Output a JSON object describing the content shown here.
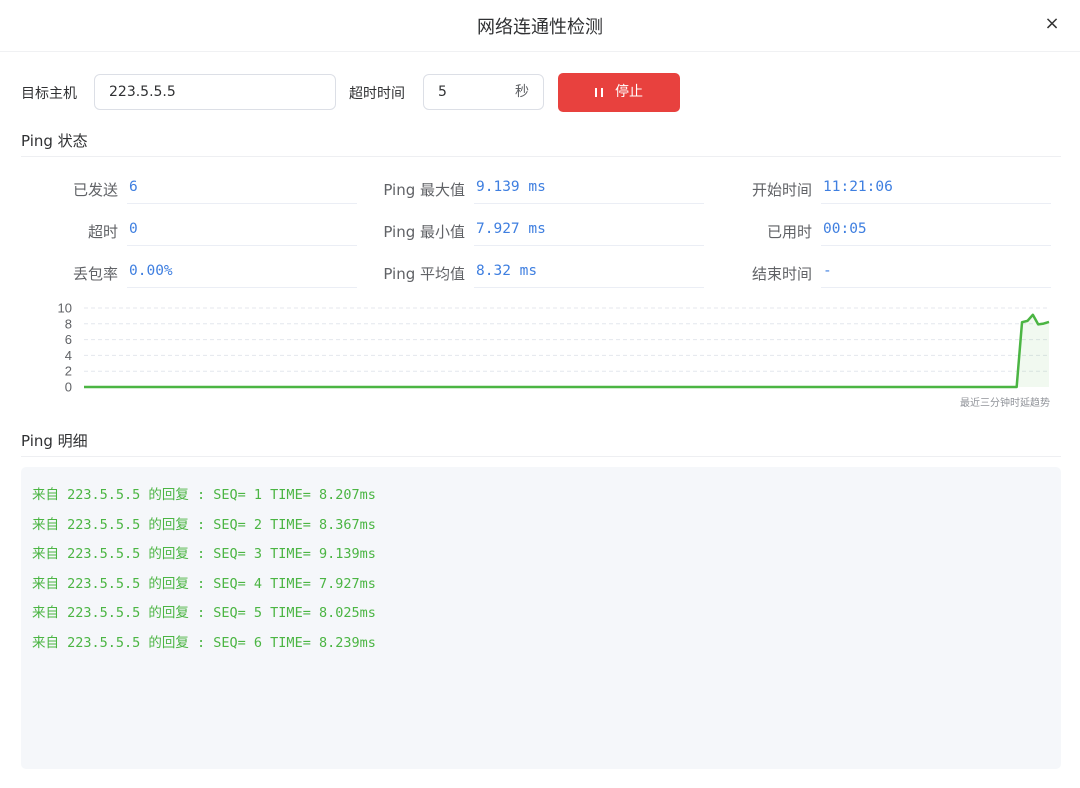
{
  "dialog": {
    "title": "网络连通性检测",
    "close_glyph": "×"
  },
  "toolbar": {
    "host_label": "目标主机",
    "host_value": "223.5.5.5",
    "timeout_label": "超时时间",
    "timeout_value": "5",
    "timeout_unit": "秒",
    "stop_label": "停止"
  },
  "status": {
    "title": "Ping 状态",
    "sent_label": "已发送",
    "sent_value": "6",
    "timeout_label": "超时",
    "timeout_value": "0",
    "loss_label": "丢包率",
    "loss_value": "0.00%",
    "max_label": "Ping 最大值",
    "max_value": "9.139 ms",
    "min_label": "Ping 最小值",
    "min_value": "7.927 ms",
    "avg_label": "Ping 平均值",
    "avg_value": "8.32 ms",
    "start_label": "开始时间",
    "start_value": "11:21:06",
    "elapsed_label": "已用时",
    "elapsed_value": "00:05",
    "end_label": "结束时间",
    "end_value": "-"
  },
  "chart_data": {
    "type": "area",
    "ylim": [
      0,
      10
    ],
    "yticks": [
      "10",
      "8",
      "6",
      "4",
      "2",
      "0"
    ],
    "grid": true,
    "note": "最近三分钟时延趋势",
    "line_color": "#4bb543",
    "x_points": 180,
    "values": [
      0,
      0,
      0,
      0,
      0,
      0,
      0,
      0,
      0,
      0,
      0,
      0,
      0,
      0,
      0,
      0,
      0,
      0,
      0,
      0,
      0,
      0,
      0,
      0,
      0,
      0,
      0,
      0,
      0,
      0,
      0,
      0,
      0,
      0,
      0,
      0,
      0,
      0,
      0,
      0,
      0,
      0,
      0,
      0,
      0,
      0,
      0,
      0,
      0,
      0,
      0,
      0,
      0,
      0,
      0,
      0,
      0,
      0,
      0,
      0,
      0,
      0,
      0,
      0,
      0,
      0,
      0,
      0,
      0,
      0,
      0,
      0,
      0,
      0,
      0,
      0,
      0,
      0,
      0,
      0,
      0,
      0,
      0,
      0,
      0,
      0,
      0,
      0,
      0,
      0,
      0,
      0,
      0,
      0,
      0,
      0,
      0,
      0,
      0,
      0,
      0,
      0,
      0,
      0,
      0,
      0,
      0,
      0,
      0,
      0,
      0,
      0,
      0,
      0,
      0,
      0,
      0,
      0,
      0,
      0,
      0,
      0,
      0,
      0,
      0,
      0,
      0,
      0,
      0,
      0,
      0,
      0,
      0,
      0,
      0,
      0,
      0,
      0,
      0,
      0,
      0,
      0,
      0,
      0,
      0,
      0,
      0,
      0,
      0,
      0,
      0,
      0,
      0,
      0,
      0,
      0,
      0,
      0,
      0,
      0,
      0,
      0,
      0,
      0,
      0,
      0,
      0,
      0,
      0,
      0,
      0,
      0,
      0,
      0,
      8.207,
      8.367,
      9.139,
      7.927,
      8.025,
      8.239
    ]
  },
  "detail": {
    "title": "Ping 明细",
    "lines": [
      "来自 223.5.5.5 的回复 : SEQ= 1 TIME= 8.207ms",
      "来自 223.5.5.5 的回复 : SEQ= 2 TIME= 8.367ms",
      "来自 223.5.5.5 的回复 : SEQ= 3 TIME= 9.139ms",
      "来自 223.5.5.5 的回复 : SEQ= 4 TIME= 7.927ms",
      "来自 223.5.5.5 的回复 : SEQ= 5 TIME= 8.025ms",
      "来自 223.5.5.5 的回复 : SEQ= 6 TIME= 8.239ms"
    ],
    "text_color": "#4bb543"
  }
}
